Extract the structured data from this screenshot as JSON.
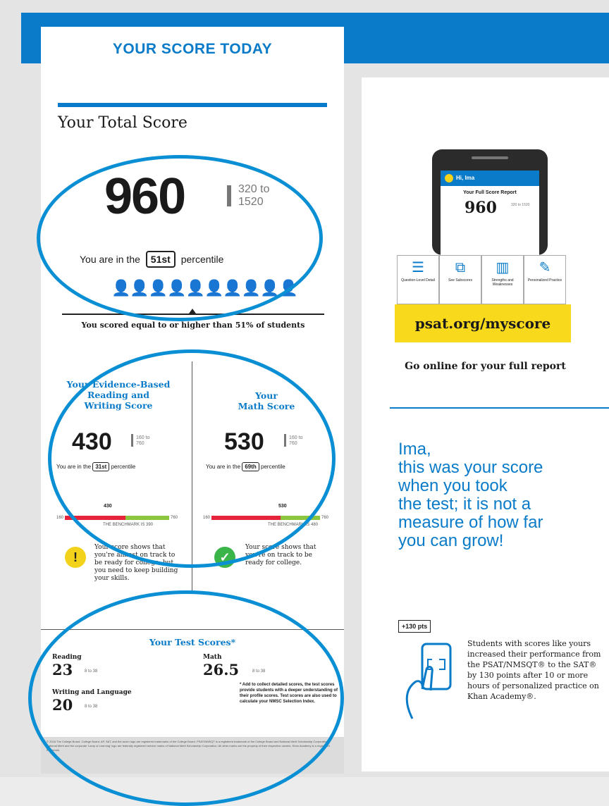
{
  "header": {
    "title": "YOUR SCORE TODAY"
  },
  "total": {
    "heading": "Your Total Score",
    "score": "960",
    "range_top": "320 to",
    "range_bottom": "1520",
    "pct_prefix": "You are in the",
    "pct_value": "51st",
    "pct_suffix": "percentile",
    "scored_text": "You scored equal to or higher than 51% of students"
  },
  "ebrw": {
    "heading_1": "Your Evidence-Based",
    "heading_2": "Reading and",
    "heading_3": "Writing Score",
    "score": "430",
    "range": "160 to 760",
    "pct_prefix": "You are in the",
    "pct_value": "31st",
    "pct_suffix": "percentile",
    "scale_min": "160",
    "scale_max": "760",
    "marker": "430",
    "benchmark_label": "THE BENCHMARK IS 390",
    "message": "Your score shows that you're almost on track to be ready for college, but you need to keep building your skills.",
    "status_color": "#f2d21b"
  },
  "math": {
    "heading_1": "Your",
    "heading_2": "Math Score",
    "score": "530",
    "range": "160 to 760",
    "pct_prefix": "You are in the",
    "pct_value": "69th",
    "pct_suffix": "percentile",
    "scale_min": "160",
    "scale_max": "760",
    "marker": "530",
    "benchmark_label": "THE BENCHMARK IS 480",
    "message": "Your score shows that you're on track to be ready for college.",
    "status_color": "#3bb54a"
  },
  "test_scores": {
    "heading": "Your Test Scores*",
    "reading_label": "Reading",
    "reading_value": "23",
    "reading_range": "8 to 38",
    "writing_label": "Writing and Language",
    "writing_value": "20",
    "writing_range": "8 to 38",
    "math_label": "Math",
    "math_value": "26.5",
    "math_range": "8 to 38",
    "note": "* Add to collect detailed scores, the test scores provide students with a deeper understanding of their profile scores. Test scores are also used to calculate your NMSC Selection Index."
  },
  "fine_print": "© 2018 The College Board. College Board, AP, SAT, and the acorn logo are registered trademarks of the College Board. PSAT/NMSQT is a registered trademark of the College Board and National Merit Scholarship Corporation. National Merit and the corporate 'Lamp of Learning' logo are federally registered service marks of National Merit Scholarship Corporation. All other marks are the property of their respective owners. Khan Academy is a registered trademark.",
  "report": {
    "greeting": "Hi, Ima",
    "phone_title": "Your Full Score Report",
    "phone_score": "960",
    "phone_range": "320 to 1520",
    "features": [
      "Question-Level Detail",
      "See Subscores",
      "Strengths and Weaknesses",
      "Personalized Practice"
    ],
    "url": "psat.org/myscore",
    "go_online": "Go online for your full report"
  },
  "message": {
    "line1": "Ima,",
    "line2": "this was your score",
    "line3": "when you took",
    "line4": "the test; it is not a",
    "line5": "measure of how far",
    "line6": "you can grow!"
  },
  "khan": {
    "pts": "+130 pts",
    "text": "Students with scores like yours increased their performance from the PSAT/NMSQT® to the SAT® by 130 points after 10 or more hours of personalized practice on Khan Academy®."
  },
  "colors": {
    "accent": "#0a7bc8",
    "highlight": "#f8d91b",
    "annotation": "#0a8fd4"
  }
}
